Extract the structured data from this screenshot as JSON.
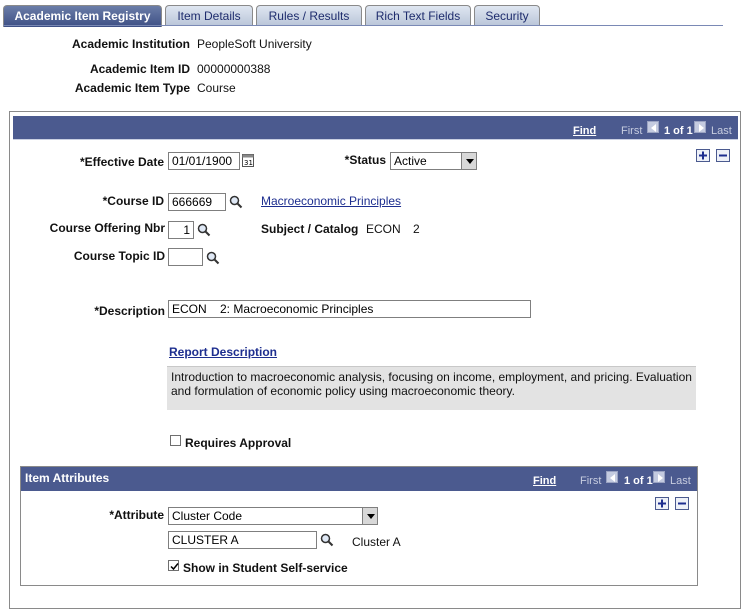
{
  "tabs": [
    {
      "label": "Academic Item Registry",
      "active": true
    },
    {
      "label": "Item Details",
      "active": false
    },
    {
      "label": "Rules / Results",
      "active": false
    },
    {
      "label": "Rich Text Fields",
      "active": false
    },
    {
      "label": "Security",
      "active": false
    }
  ],
  "header": {
    "institution_label": "Academic Institution",
    "institution_value": "PeopleSoft University",
    "item_id_label": "Academic Item ID",
    "item_id_value": "00000000388",
    "item_type_label": "Academic Item Type",
    "item_type_value": "Course"
  },
  "grid_nav": {
    "find": "Find",
    "first": "First",
    "range": "1 of 1",
    "last": "Last"
  },
  "form": {
    "effective_date_label": "*Effective Date",
    "effective_date_value": "01/01/1900",
    "status_label": "*Status",
    "status_value": "Active",
    "course_id_label": "*Course ID",
    "course_id_value": "666669",
    "course_title_link": "Macroeconomic Principles",
    "offering_nbr_label": "Course Offering Nbr",
    "offering_nbr_value": "1",
    "subject_catalog_label": "Subject / Catalog",
    "subject_value": "ECON",
    "catalog_value": "2",
    "topic_id_label": "Course Topic ID",
    "topic_id_value": "",
    "description_label": "*Description",
    "description_value": "ECON    2: Macroeconomic Principles",
    "report_description_link": "Report Description",
    "report_description_text": "Introduction to macroeconomic analysis, focusing on income, employment, and pricing. Evaluation and formulation of economic policy using macroeconomic theory.",
    "requires_approval_label": "Requires Approval",
    "requires_approval_checked": false
  },
  "attributes": {
    "title": "Item Attributes",
    "find": "Find",
    "first": "First",
    "range": "1 of 1",
    "last": "Last",
    "attribute_label": "*Attribute",
    "attribute_value": "Cluster Code",
    "attribute_code_value": "CLUSTER A",
    "attribute_code_desc": "Cluster A",
    "show_self_service_label": "Show in Student Self-service",
    "show_self_service_checked": true
  },
  "colors": {
    "header_bar": "#4b5a8f",
    "active_tab": "#4b5a8f",
    "link": "#1d2e8f",
    "report_desc_bg": "#e3e3e3"
  },
  "icons": {
    "calendar": "calendar-icon",
    "lookup": "magnifier-icon",
    "add_row": "plus-icon",
    "delete_row": "minus-icon",
    "first": "left-arrow-icon",
    "last": "right-arrow-icon"
  }
}
